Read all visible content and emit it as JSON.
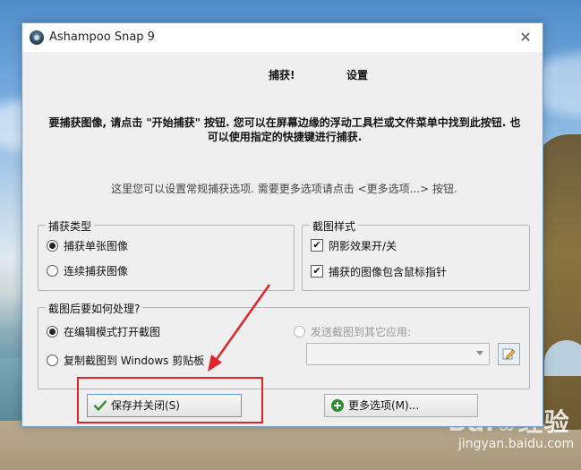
{
  "window": {
    "title": "Ashampoo Snap 9",
    "close_glyph": "✕"
  },
  "tabs": [
    {
      "label": "捕获!"
    },
    {
      "label": "设置"
    }
  ],
  "intro_text": "要捕获图像, 请点击 \"开始捕获\" 按钮. 您可以在屏幕边缘的浮动工具栏或文件菜单中找到此按钮. 也可以使用指定的快捷键进行捕获.",
  "hint_text": "这里您可以设置常规捕获选项. 需要更多选项请点击 <更多选项...> 按钮.",
  "capture_type": {
    "legend": "捕获类型",
    "options": [
      {
        "label": "捕获单张图像",
        "selected": true
      },
      {
        "label": "连续捕获图像",
        "selected": false
      }
    ]
  },
  "screenshot_style": {
    "legend": "截图样式",
    "options": [
      {
        "label": "阴影效果开/关",
        "checked": true
      },
      {
        "label": "捕获的图像包含鼠标指针",
        "checked": true
      }
    ]
  },
  "after_capture": {
    "legend": "截图后要如何处理?",
    "options": [
      {
        "label": "在编辑模式打开截图",
        "selected": true
      },
      {
        "label": "复制截图到 Windows 剪贴板",
        "selected": false
      }
    ],
    "send_option": {
      "label": "发送截图到其它应用:",
      "enabled": false
    },
    "app_select_value": ""
  },
  "buttons": {
    "save_close": "保存并关闭(S)",
    "more_options": "更多选项(M)..."
  },
  "watermark": {
    "brand_left": "Bai",
    "brand_right": "经验",
    "url": "jingyan.baidu.com"
  },
  "colors": {
    "accent_border": "#5b9bd5",
    "annotation_red": "#e0242b",
    "check_green": "#2e8b2e"
  },
  "icons": {
    "app": "camera-lens-icon",
    "save_button": "check-icon",
    "more_button": "plus-circle-icon",
    "edit": "edit-pencil-icon"
  }
}
